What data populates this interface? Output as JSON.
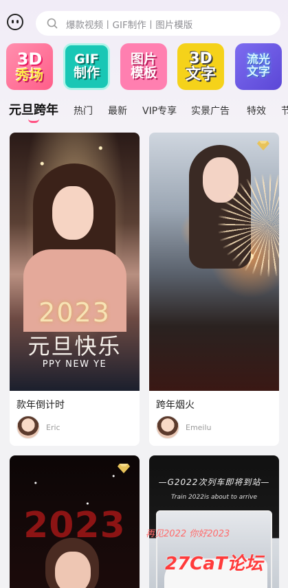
{
  "search": {
    "placeholder_text": "爆款视频丨GIF制作丨图片模版"
  },
  "tiles": [
    {
      "line1": "3D",
      "line2": "秀场"
    },
    {
      "line1": "GIF",
      "line2": "制作"
    },
    {
      "line1": "图片",
      "line2": "模板"
    },
    {
      "line1": "3D",
      "line2": "文字"
    },
    {
      "line1": "流光",
      "line2": "文字"
    }
  ],
  "tabs": [
    "元旦跨年",
    "热门",
    "最新",
    "VIP专享",
    "实景广告",
    "特效",
    "节"
  ],
  "active_tab_index": 0,
  "cards": [
    {
      "title": "款年倒计时",
      "author": "Eric",
      "art": {
        "year": "2023",
        "headline": "元旦快乐",
        "subline": "PPY NEW YE"
      },
      "vip": false
    },
    {
      "title": "跨年烟火",
      "author": "Emeilu",
      "vip": true
    },
    {
      "art": {
        "year": "2023"
      },
      "vip": true
    },
    {
      "art": {
        "line1": "—G2022次列车即将到站—",
        "line2": "Train 2022is about to arrive"
      },
      "vip": false
    }
  ],
  "watermark": {
    "main": "27CaT论坛",
    "sub": "再见2022 你好2023"
  },
  "colors": {
    "accent": "#ff4f80",
    "background": "#f2f2f4",
    "vip_gold": "#e8c35a"
  }
}
